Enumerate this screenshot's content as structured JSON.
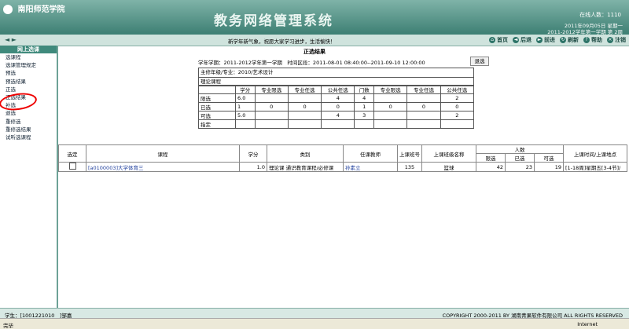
{
  "header": {
    "logo_text": "南阳师范学院",
    "system_title": "教务网络管理系统",
    "online_label": "在线人数：1110",
    "date_line": "2011年09月05日 星期一",
    "term_line": "2011-2012学年第一学期 第 2周"
  },
  "bar": {
    "arrows": "◄ ►",
    "notice": "新学年新气象，祝愿大家学习进步，生活愉快！",
    "nav": [
      {
        "label": "首页",
        "icon": "home-icon"
      },
      {
        "label": "后退",
        "icon": "back-icon"
      },
      {
        "label": "前进",
        "icon": "forward-icon"
      },
      {
        "label": "刷新",
        "icon": "refresh-icon"
      },
      {
        "label": "帮助",
        "icon": "help-icon"
      },
      {
        "label": "注销",
        "icon": "logout-icon"
      }
    ]
  },
  "sidebar": {
    "heading": "网上选课",
    "items": [
      "选课程",
      "选课管理规定",
      "预选",
      "预选结果",
      "正选",
      "正选结果",
      "补选",
      "退选",
      "重修选",
      "重修选结果",
      "试听选课程"
    ]
  },
  "main": {
    "title": "正选结果",
    "term_info": "学年学期：2011-2012学年第一学期　时间区段：2011-08-01 08:40:00--2011-09-10 12:00:00",
    "back_button": "退选",
    "major_line": "主修年级/专业：2010/艺术设计",
    "course_cat": "理论课程"
  },
  "stats": {
    "headers": [
      "学分",
      "专业限选",
      "专业任选",
      "公共任选",
      "门数",
      "专业限选",
      "专业任选",
      "公共任选"
    ],
    "rows": [
      {
        "label": "限选",
        "values": [
          "6.0",
          "",
          "",
          "4",
          "4",
          "",
          "",
          "2"
        ]
      },
      {
        "label": "已选",
        "values": [
          "1",
          "0",
          "0",
          "0",
          "1",
          "0",
          "0",
          "0"
        ]
      },
      {
        "label": "可选",
        "values": [
          "5.0",
          "",
          "",
          "4",
          "3",
          "",
          "",
          "2"
        ]
      },
      {
        "label": "指定",
        "values": [
          "",
          "",
          "",
          "",
          "",
          "",
          "",
          ""
        ]
      }
    ]
  },
  "courses": {
    "headers": {
      "select": "选定",
      "course": "课程",
      "credit": "学分",
      "category": "类别",
      "teacher": "任课教师",
      "class_no": "上课班号",
      "class_name": "上课班级名称",
      "count": "人数",
      "limit": "限选",
      "chosen": "已选",
      "avail": "可选",
      "time_place": "上课时间/上课地点"
    },
    "rows": [
      {
        "course": "[a0100003]大学体育三",
        "credit": "1.0",
        "category": "理论课 通识教育课程/必修课",
        "teacher": "孙素立",
        "class_no": "135",
        "class_name": "篮球",
        "limit": "42",
        "chosen": "23",
        "avail": "19",
        "time_place": "[1-18周]星期五[3-4节]/"
      }
    ]
  },
  "footer": {
    "student": "学生：[1001221010　]邹嘉",
    "copyright": "COPYRIGHT 2000-2011 BY 湖南青果软件有限公司 ALL RIGHTS RESERVED"
  },
  "status": {
    "done": "完毕",
    "zone": "Internet"
  }
}
